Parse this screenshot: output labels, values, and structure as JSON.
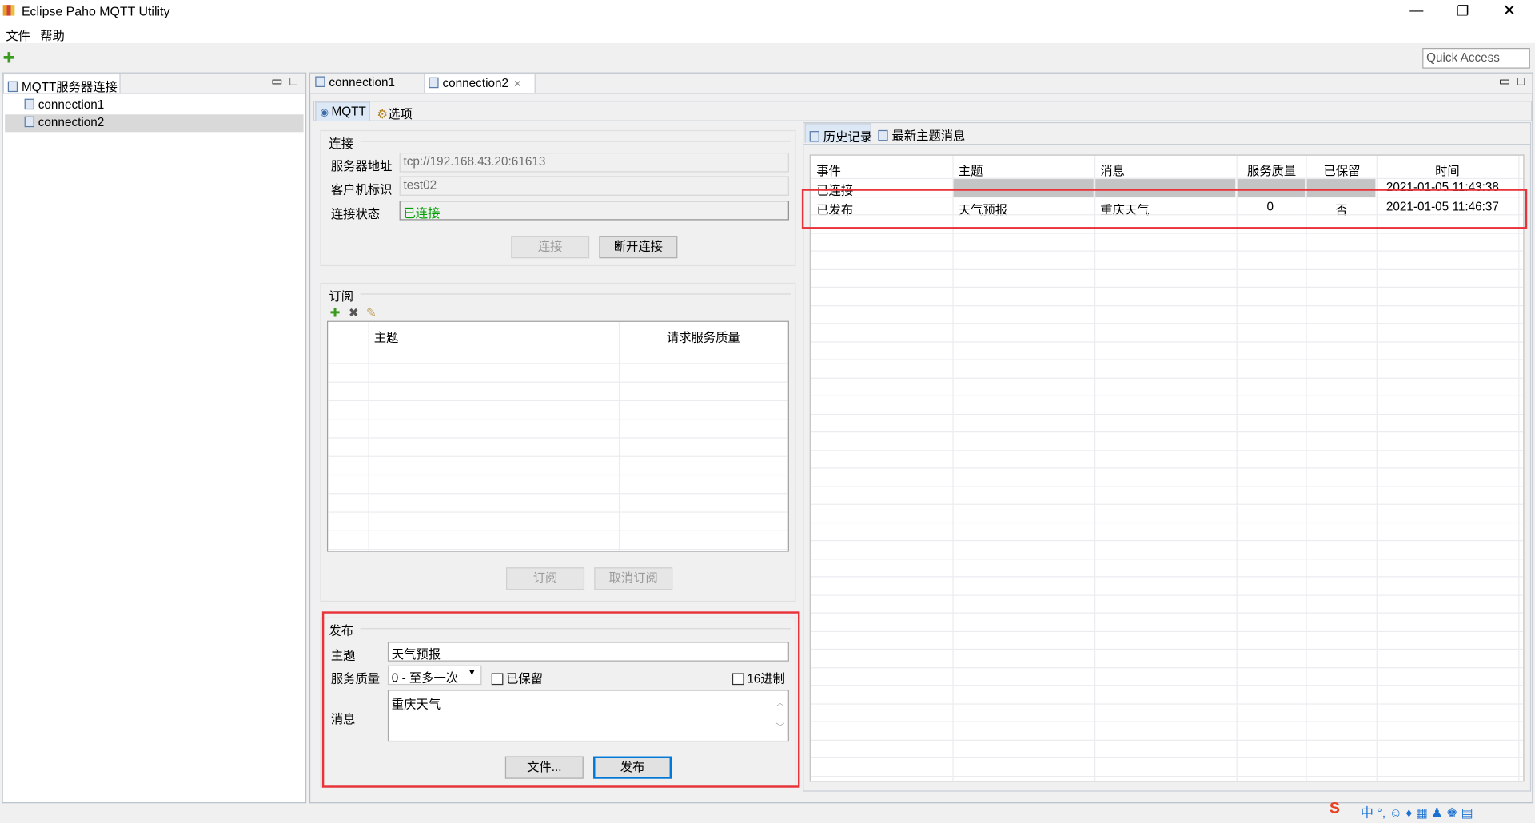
{
  "window": {
    "title": "Eclipse Paho MQTT Utility",
    "controls": [
      "minimize",
      "restore",
      "close"
    ]
  },
  "menu": [
    "文件",
    "帮助"
  ],
  "toolbar": {
    "quick_access": "Quick Access"
  },
  "left_panel": {
    "title": "MQTT服务器连接",
    "items": [
      {
        "label": "connection1",
        "selected": false
      },
      {
        "label": "connection2",
        "selected": true
      }
    ]
  },
  "editor": {
    "tabs": [
      {
        "label": "connection1",
        "active": false
      },
      {
        "label": "connection2",
        "active": true
      }
    ],
    "subtabs": [
      "MQTT",
      "选项"
    ],
    "connect": {
      "title": "连接",
      "server_label": "服务器地址",
      "server_value": "tcp://192.168.43.20:61613",
      "client_label": "客户机标识",
      "client_value": "test02",
      "status_label": "连接状态",
      "status_value": "已连接",
      "status_color": "#00a000",
      "connect_btn": "连接",
      "disconnect_btn": "断开连接"
    },
    "subscribe": {
      "title": "订阅",
      "columns": [
        "",
        "主题",
        "请求服务质量"
      ],
      "subscribe_btn": "订阅",
      "unsubscribe_btn": "取消订阅"
    },
    "publish": {
      "title": "发布",
      "topic_label": "主题",
      "topic_value": "天气预报",
      "qos_label": "服务质量",
      "qos_value": "0 - 至多一次",
      "retained_label": "已保留",
      "retained": false,
      "hex_label": "16进制",
      "hex": false,
      "message_label": "消息",
      "message_value": "重庆天气",
      "file_btn": "文件...",
      "publish_btn": "发布"
    },
    "history": {
      "tabs": [
        "历史记录",
        "最新主题消息"
      ],
      "columns": [
        "事件",
        "主题",
        "消息",
        "服务质量",
        "已保留",
        "时间"
      ],
      "rows": [
        [
          "已连接",
          "",
          "",
          "",
          "",
          "2021-01-05 11:43:38"
        ],
        [
          "已发布",
          "天气预报",
          "重庆天气",
          "0",
          "否",
          "2021-01-05 11:46:37"
        ]
      ]
    }
  },
  "highlight_color": "#e8333a"
}
